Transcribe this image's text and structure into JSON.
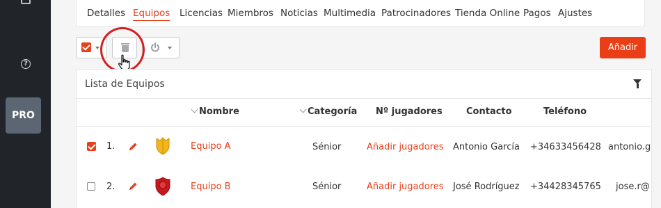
{
  "sidebar": {
    "pro_label": "PRO",
    "help_glyph": "?"
  },
  "tabs": [
    {
      "label": "Detalles",
      "active": false
    },
    {
      "label": "Equipos",
      "active": true
    },
    {
      "label": "Licencias",
      "active": false
    },
    {
      "label": "Miembros",
      "active": false
    },
    {
      "label": "Noticias",
      "active": false
    },
    {
      "label": "Multimedia",
      "active": false
    },
    {
      "label": "Patrocinadores",
      "active": false
    },
    {
      "label": "Tienda Online",
      "active": false
    },
    {
      "label": "Pagos",
      "active": false
    },
    {
      "label": "Ajustes",
      "active": false
    }
  ],
  "toolbar": {
    "add_label": "Añadir",
    "select_all_checked": true
  },
  "list": {
    "title": "Lista de Equipos",
    "columns": {
      "name": "Nombre",
      "category": "Categoría",
      "players": "Nº jugadores",
      "contact": "Contacto",
      "phone": "Teléfono"
    },
    "rows": [
      {
        "number": "1.",
        "checked": true,
        "name": "Equipo A",
        "category": "Sénior",
        "players": "Añadir jugadores",
        "contact": "Antonio García",
        "phone": "+34633456428",
        "email": "antonio.g",
        "badge_color": "#f2b61b"
      },
      {
        "number": "2.",
        "checked": false,
        "name": "Equipo B",
        "category": "Sénior",
        "players": "Añadir jugadores",
        "contact": "José Rodríguez",
        "phone": "+34428345765",
        "email": "jose.r@",
        "badge_color": "#c8181c"
      }
    ]
  },
  "colors": {
    "accent": "#e8401c",
    "sidebar": "#212529",
    "highlight": "#d51e1e"
  }
}
